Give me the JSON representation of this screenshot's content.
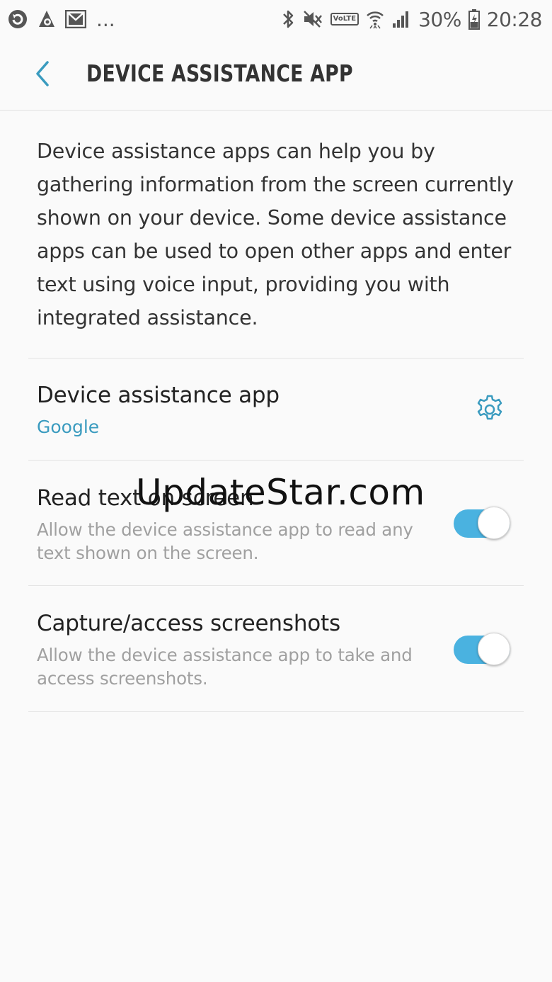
{
  "status_bar": {
    "left_icons": [
      "sync-icon",
      "app-notification-icon",
      "gmail-icon"
    ],
    "more": "...",
    "right_icons": [
      "bluetooth-icon",
      "mute-icon",
      "volte-icon",
      "wifi-icon",
      "signal-icon"
    ],
    "volte": "VoLTE",
    "battery": "30%",
    "time": "20:28"
  },
  "header": {
    "title": "DEVICE ASSISTANCE APP"
  },
  "description": "Device assistance apps can help you by gathering information from the screen currently shown on your device. Some device assistance apps can be used to open other apps and enter text using voice input, providing you with integrated assistance.",
  "settings": [
    {
      "title": "Device assistance app",
      "value": "Google",
      "icon": "gear-icon"
    },
    {
      "title": "Read text on screen",
      "subtitle": "Allow the device assistance app to read any text shown on the screen.",
      "enabled": true
    },
    {
      "title": "Capture/access screenshots",
      "subtitle": "Allow the device assistance app to take and access screenshots.",
      "enabled": true
    }
  ],
  "watermark": "UpdateStar.com",
  "colors": {
    "accent": "#3a9bbf",
    "toggle_on": "#4ab2e0",
    "background": "#fafafa"
  }
}
